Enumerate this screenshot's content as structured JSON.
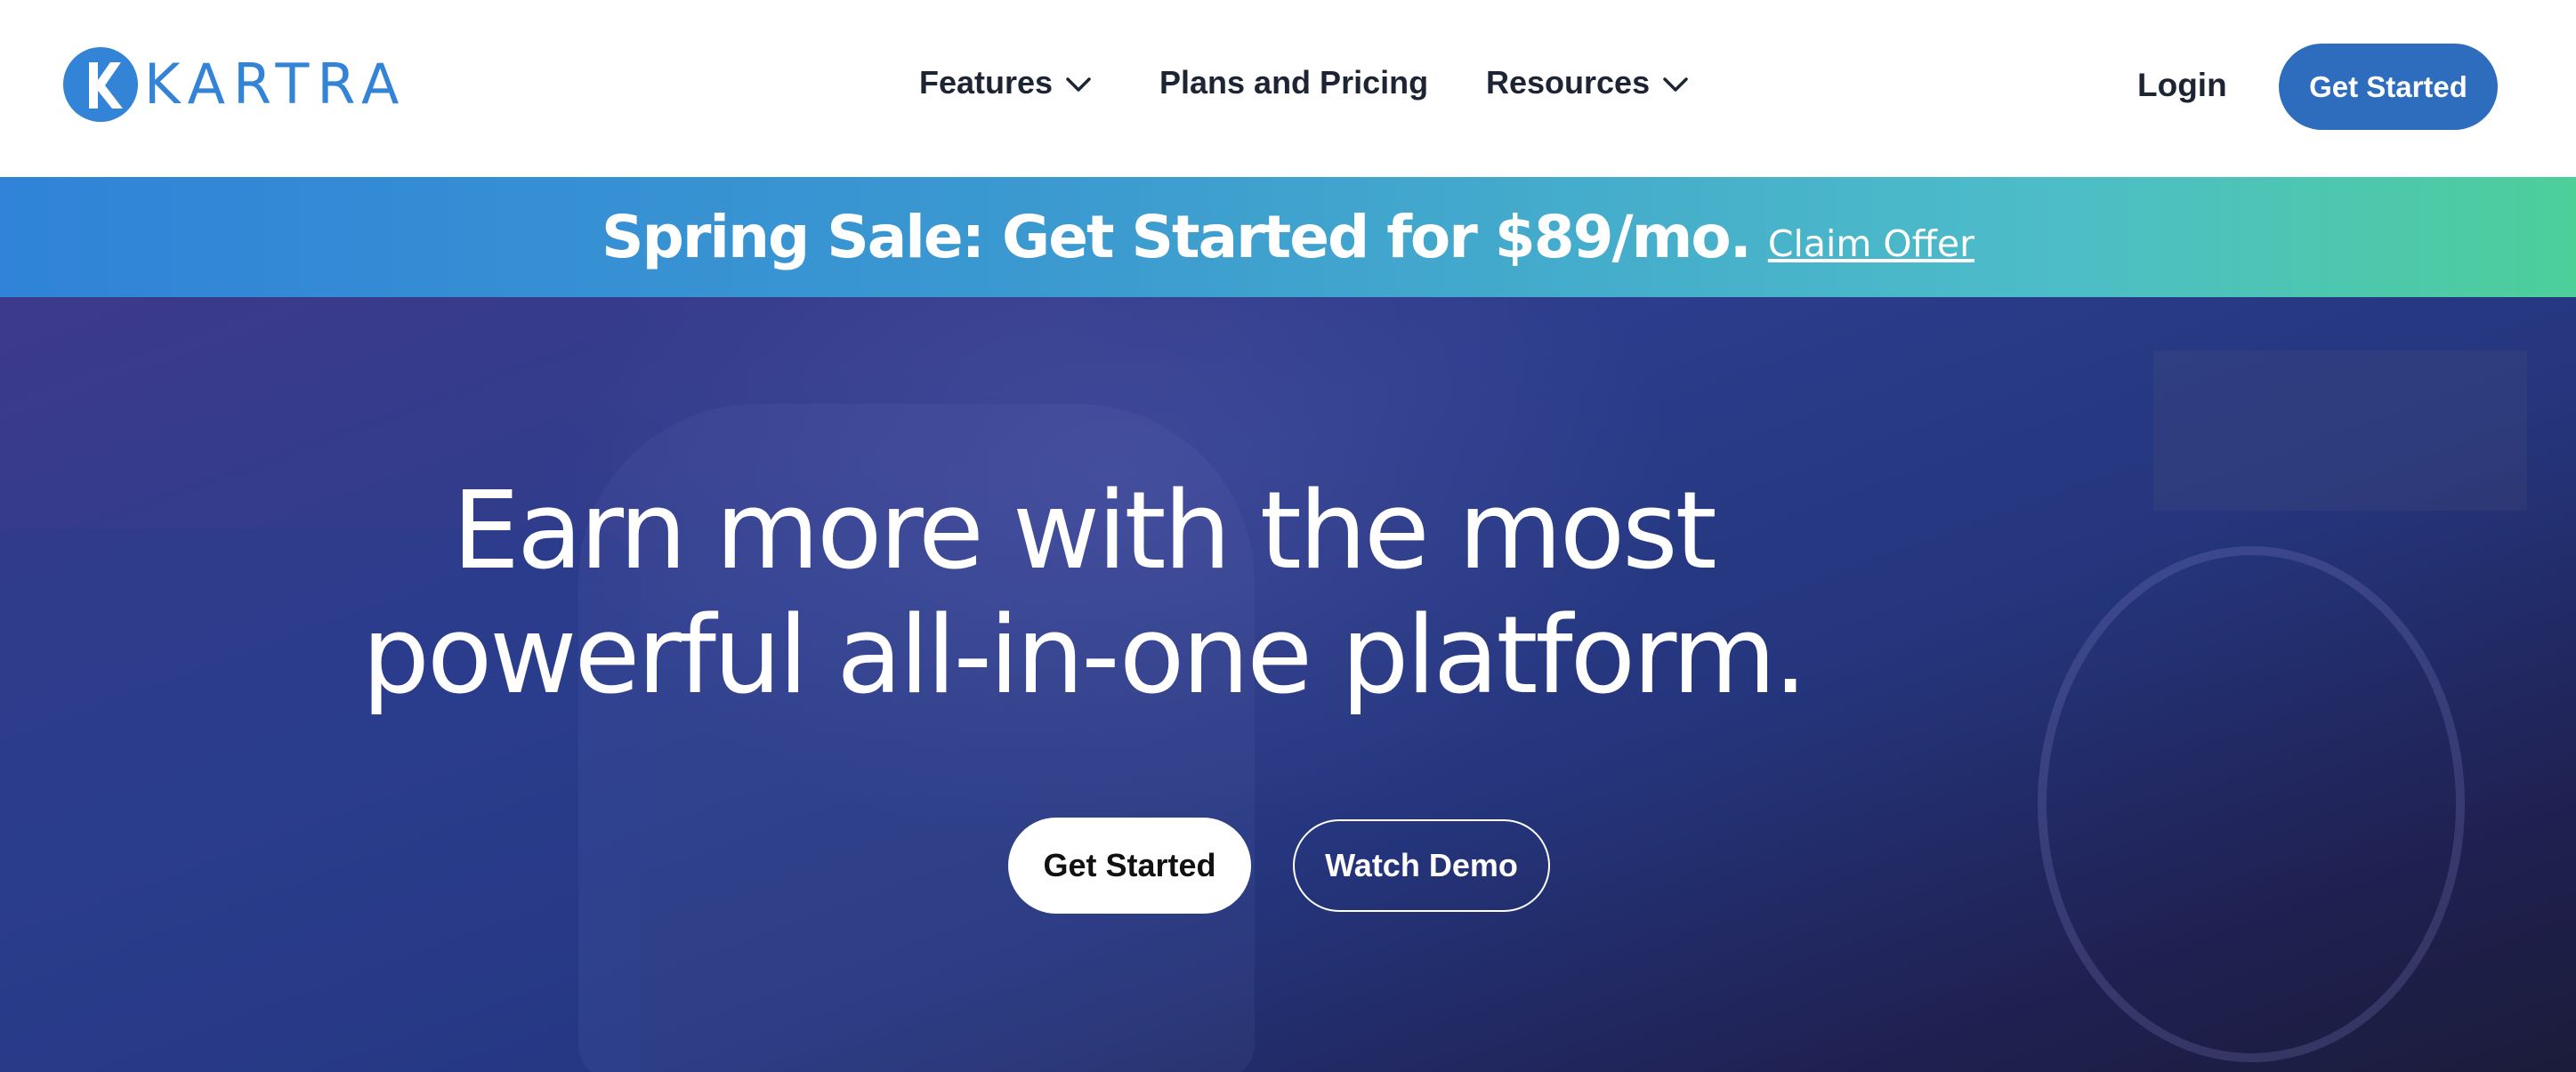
{
  "header": {
    "logo_text": "KARTRA",
    "logo_icon": "kartra-k-icon",
    "nav": [
      {
        "label": "Features",
        "has_dropdown": true,
        "icon": "chevron-down-icon"
      },
      {
        "label": "Plans and Pricing",
        "has_dropdown": false
      },
      {
        "label": "Resources",
        "has_dropdown": true,
        "icon": "chevron-down-icon"
      }
    ],
    "login_label": "Login",
    "cta_label": "Get Started"
  },
  "promo": {
    "text": "Spring Sale: Get Started for $89/mo.",
    "link_label": "Claim Offer"
  },
  "hero": {
    "title_line1": "Earn more with the most",
    "title_line2": "powerful all-in-one platform.",
    "primary_cta": "Get Started",
    "secondary_cta": "Watch Demo"
  },
  "colors": {
    "brand_blue": "#3383d6",
    "button_blue": "#2e6dbd",
    "nav_text": "#1d2433",
    "promo_gradient_start": "#3083d8",
    "promo_gradient_end": "#4dcf9a",
    "hero_bg": "#2b3d8c"
  }
}
